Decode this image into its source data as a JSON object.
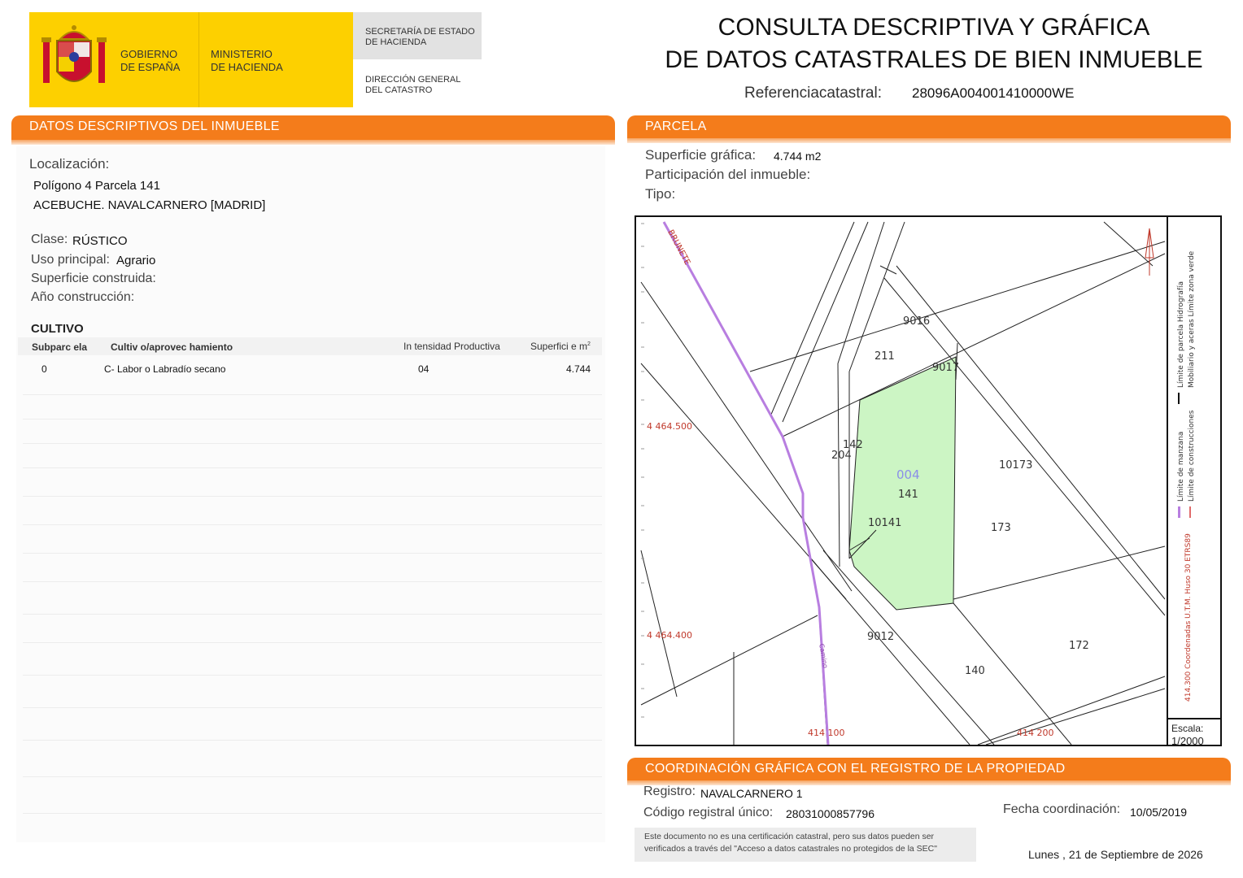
{
  "header": {
    "gov_line1": "GOBIERNO",
    "gov_line2": "DE ESPAÑA",
    "ministry_line1": "MINISTERIO",
    "ministry_line2": "DE HACIENDA",
    "secretaria_line1": "SECRETARÍA DE ESTADO",
    "secretaria_line2": "DE HACIENDA",
    "direccion_line1": "DIRECCIÓN GENERAL",
    "direccion_line2": "DEL CATASTRO",
    "title_line1": "CONSULTA DESCRIPTIVA Y GRÁFICA",
    "title_line2": "DE DATOS CATASTRALES DE BIEN INMUEBLE",
    "ref_label": "Referenciacatastral:",
    "ref_value": "28096A004001410000WE"
  },
  "descriptivos": {
    "section_title": "DATOS DESCRIPTIVOS DEL INMUEBLE",
    "localizacion_label": "Localización:",
    "localizacion_line1": "Polígono 4 Parcela 141",
    "localizacion_line2": "ACEBUCHE. NAVALCARNERO [MADRID]",
    "clase_label": "Clase:",
    "clase_value": "RÚSTICO",
    "uso_label": "Uso principal:",
    "uso_value": "Agrario",
    "superficie_label": "Superficie construida:",
    "anio_label": "Año construcción:"
  },
  "cultivo": {
    "title": "CULTIVO",
    "headers": {
      "subparcela": "Subparc ela",
      "cultivo": "Cultiv o/aprovec hamiento",
      "intensidad": "In tensidad Productiva",
      "superficie": "Superfici e m"
    },
    "superficie_sup": "2",
    "rows": [
      {
        "subparcela": "0",
        "cultivo": "C- Labor o Labradío secano",
        "intensidad": "04",
        "superficie": "4.744"
      }
    ]
  },
  "parcela": {
    "section_title": "PARCELA",
    "superficie_label": "Superficie gráfica:",
    "superficie_value": "4.744 m2",
    "participacion_label": "Participación del inmueble:",
    "tipo_label": "Tipo:"
  },
  "map": {
    "labels": {
      "road": "BRUNETE",
      "camino": "Camino",
      "p9016": "9016",
      "p211": "211",
      "p9017": "9017",
      "p142": "142",
      "p204": "204",
      "poligono": "004",
      "parcela": "141",
      "p10173": "10173",
      "p10141": "10141",
      "p173": "173",
      "p9012": "9012",
      "p172": "172",
      "p140": "140",
      "y_coord1": "4 464.500",
      "y_coord2": "4 464.400",
      "x_coord1": "414 100",
      "x_coord2": "414 200"
    },
    "legend": {
      "hidrografia": "Límite de parcela Hidrografía",
      "mobiliario": "Mobiliario y aceras Límite zona verde",
      "manzana": "Límite de manzana",
      "construcciones": "Límite de construcciones",
      "coords": "414.300 Coordenadas U.T.M. Huso 30 ETRS89"
    },
    "scale_label": "Escala:",
    "scale_value": "1/2000",
    "colors": {
      "parcel_fill": "#ccf5c4",
      "road_line": "#b87ee0",
      "coord_text": "#c0392b"
    }
  },
  "coordinacion": {
    "section_title": "COORDINACIÓN GRÁFICA CON EL REGISTRO DE LA PROPIEDAD",
    "registro_label": "Registro:",
    "registro_value": "NAVALCARNERO 1",
    "codigo_label": "Código registral único:",
    "codigo_value": "28031000857796",
    "fecha_label": "Fecha coordinación:",
    "fecha_value": "10/05/2019",
    "notice_line1": "Este documento no es una certificación catastral, pero sus datos pueden ser",
    "notice_line2": "verificados a través del \"Acceso a datos catastrales no protegidos de la SEC\""
  },
  "footer": {
    "date": "Lunes , 21 de Septiembre de 2026"
  },
  "colors": {
    "accent": "#f47c1b",
    "logo_yellow": "#fdd000"
  }
}
